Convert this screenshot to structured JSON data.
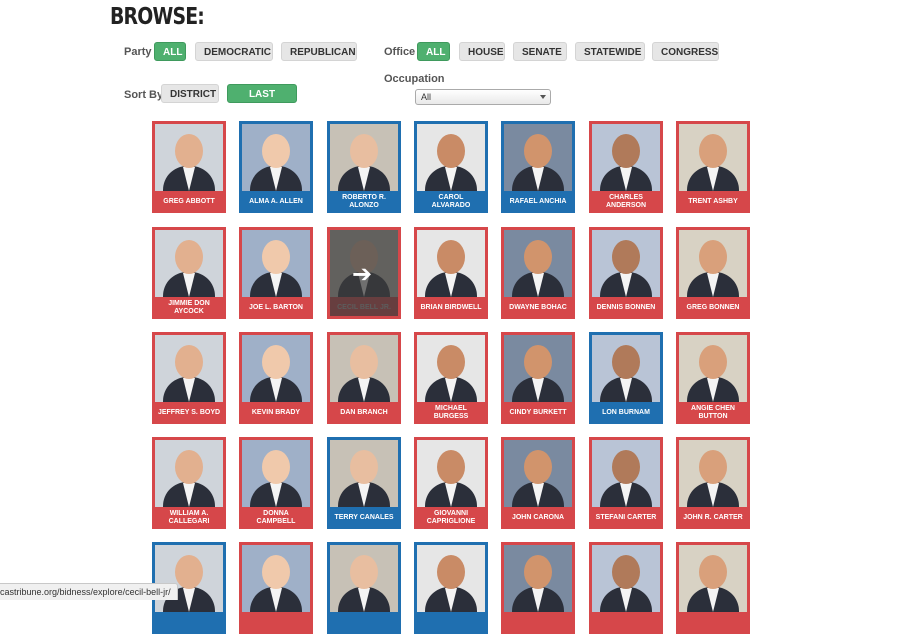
{
  "page": {
    "title": "BROWSE:"
  },
  "filters": {
    "party": {
      "label": "Party",
      "options": [
        "ALL",
        "DEMOCRATIC",
        "REPUBLICAN"
      ],
      "selected": "ALL"
    },
    "office": {
      "label": "Office",
      "options": [
        "ALL",
        "HOUSE",
        "SENATE",
        "STATEWIDE",
        "CONGRESS"
      ],
      "selected": "ALL"
    },
    "sort": {
      "label": "Sort By",
      "options": [
        "DISTRICT",
        "LAST NAME"
      ],
      "selected": "LAST NAME"
    },
    "occupation": {
      "label": "Occupation",
      "value": "All"
    }
  },
  "colors": {
    "republican": "#d6474a",
    "democrat": "#1f6fb0",
    "active": "#4fb06f"
  },
  "hover_icon": "arrow-right-icon",
  "people": [
    {
      "name": "GREG ABBOTT",
      "party": "R"
    },
    {
      "name": "ALMA A. ALLEN",
      "party": "D"
    },
    {
      "name": "ROBERTO R. ALONZO",
      "party": "D"
    },
    {
      "name": "CAROL ALVARADO",
      "party": "D"
    },
    {
      "name": "RAFAEL ANCHIA",
      "party": "D"
    },
    {
      "name": "CHARLES ANDERSON",
      "party": "R"
    },
    {
      "name": "TRENT ASHBY",
      "party": "R"
    },
    {
      "name": "JIMMIE DON AYCOCK",
      "party": "R"
    },
    {
      "name": "JOE L. BARTON",
      "party": "R"
    },
    {
      "name": "CECIL BELL JR.",
      "party": "R",
      "hover": true
    },
    {
      "name": "BRIAN BIRDWELL",
      "party": "R"
    },
    {
      "name": "DWAYNE BOHAC",
      "party": "R"
    },
    {
      "name": "DENNIS BONNEN",
      "party": "R"
    },
    {
      "name": "GREG BONNEN",
      "party": "R"
    },
    {
      "name": "JEFFREY S. BOYD",
      "party": "R"
    },
    {
      "name": "KEVIN BRADY",
      "party": "R"
    },
    {
      "name": "DAN BRANCH",
      "party": "R"
    },
    {
      "name": "MICHAEL BURGESS",
      "party": "R"
    },
    {
      "name": "CINDY BURKETT",
      "party": "R"
    },
    {
      "name": "LON BURNAM",
      "party": "D"
    },
    {
      "name": "ANGIE CHEN BUTTON",
      "party": "R"
    },
    {
      "name": "WILLIAM A. CALLEGARI",
      "party": "R"
    },
    {
      "name": "DONNA CAMPBELL",
      "party": "R"
    },
    {
      "name": "TERRY CANALES",
      "party": "D"
    },
    {
      "name": "GIOVANNI CAPRIGLIONE",
      "party": "R"
    },
    {
      "name": "JOHN CARONA",
      "party": "R"
    },
    {
      "name": "STEFANI CARTER",
      "party": "R"
    },
    {
      "name": "JOHN R. CARTER",
      "party": "R"
    },
    {
      "name": "",
      "party": "D"
    },
    {
      "name": "",
      "party": "R"
    },
    {
      "name": "",
      "party": "D"
    },
    {
      "name": "",
      "party": "D"
    },
    {
      "name": "",
      "party": "R"
    },
    {
      "name": "",
      "party": "R"
    },
    {
      "name": "",
      "party": "R"
    }
  ],
  "status_bar": {
    "url": "castribune.org/bidness/explore/cecil-bell-jr/"
  }
}
